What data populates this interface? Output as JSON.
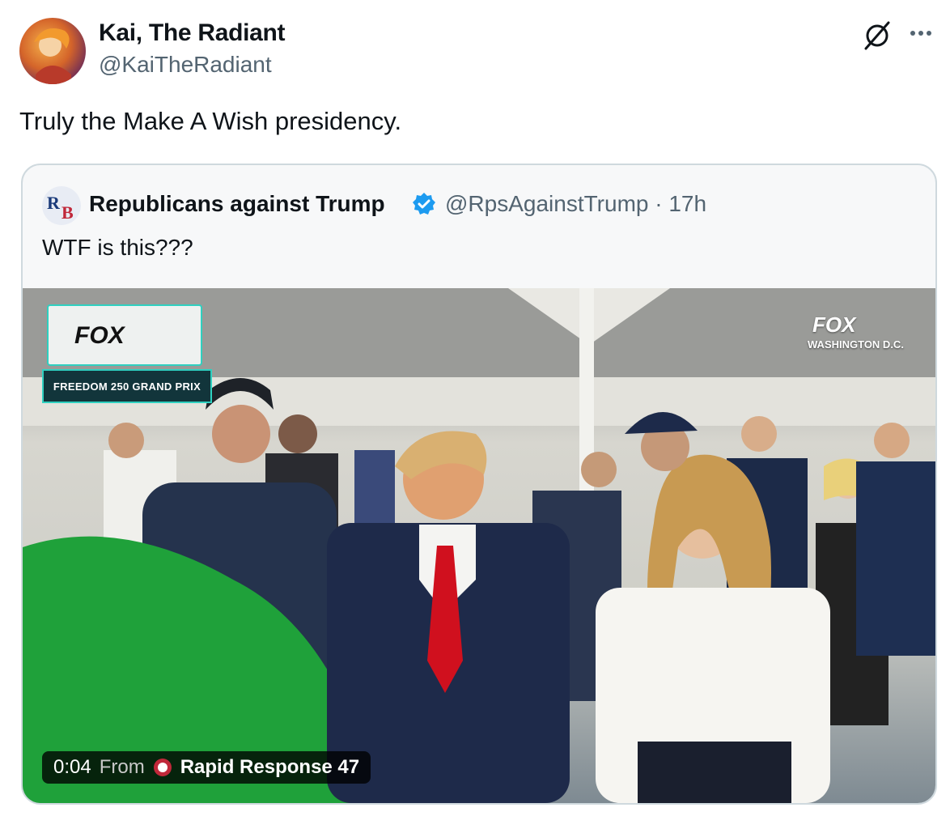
{
  "tweet": {
    "display_name": "Kai, The Radiant",
    "handle": "@KaiTheRadiant",
    "text": "Truly the Make A Wish presidency."
  },
  "quote": {
    "display_name": "Republicans against Trump",
    "verified": true,
    "handle_time": "@RpsAgainstTrump · 17h",
    "text": "WTF is this???"
  },
  "video": {
    "time": "0:04",
    "from_label": "From",
    "source": "Rapid Response 47",
    "overlay_fox": "FOX",
    "overlay_race": "FREEDOM 250 GRAND PRIX",
    "overlay_fox_right": "FOX",
    "overlay_location": "WASHINGTON D.C."
  },
  "colors": {
    "accent": "#1d9bf0",
    "secondary_text": "#536471",
    "border": "#cfd9de"
  },
  "icons": {
    "grok": "grok-icon",
    "more": "more-icon",
    "verified": "verified-badge-icon"
  }
}
